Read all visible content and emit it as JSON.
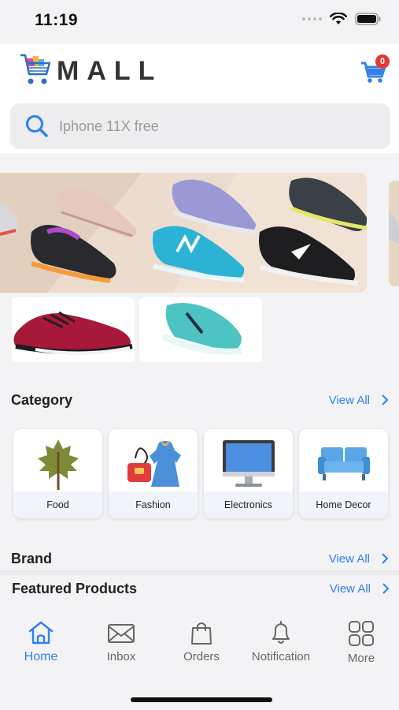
{
  "status_bar": {
    "time": "11:19"
  },
  "header": {
    "logo_text": "MALL",
    "cart_count": "0",
    "search_placeholder": "Iphone 11X free"
  },
  "category_section": {
    "title": "Category",
    "view_all": "View All",
    "items": [
      {
        "label": "Food",
        "icon": "leaf-icon"
      },
      {
        "label": "Fashion",
        "icon": "fashion-icon"
      },
      {
        "label": "Electronics",
        "icon": "monitor-icon"
      },
      {
        "label": "Home Decor",
        "icon": "sofa-icon"
      }
    ]
  },
  "brand_section": {
    "title": "Brand",
    "view_all": "View All"
  },
  "featured_section": {
    "title": "Featured Products",
    "view_all": "View All"
  },
  "bottom_nav": {
    "active": "Home",
    "items": [
      {
        "label": "Home",
        "icon": "home-icon"
      },
      {
        "label": "Inbox",
        "icon": "mail-icon"
      },
      {
        "label": "Orders",
        "icon": "shopping-bag-icon"
      },
      {
        "label": "Notification",
        "icon": "bell-icon"
      },
      {
        "label": "More",
        "icon": "grid-icon"
      }
    ]
  },
  "colors": {
    "accent": "#2f80ed",
    "badge": "#e53935",
    "background": "#f3f3f5"
  }
}
